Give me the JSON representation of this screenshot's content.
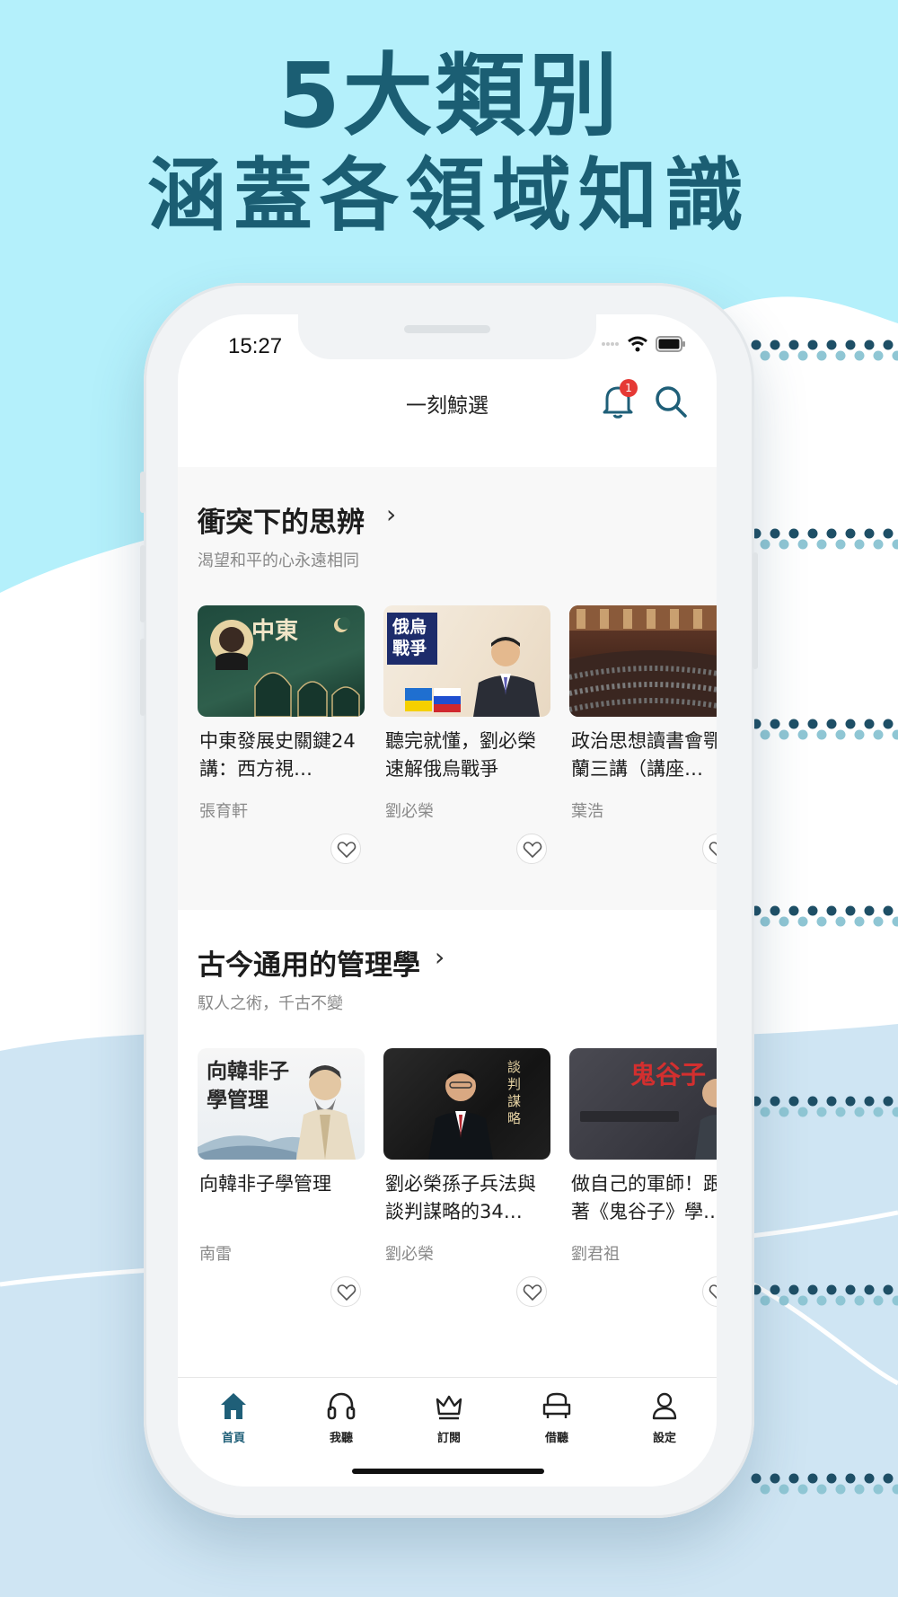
{
  "headline": {
    "line1": "5大類別",
    "line2": "涵蓋各領域知識"
  },
  "status_bar": {
    "time": "15:27"
  },
  "app_header": {
    "title": "一刻鯨選",
    "notification_count": "1"
  },
  "sections": [
    {
      "title": "衝突下的思辨",
      "subtitle": "渴望和平的心永遠相同",
      "cards": [
        {
          "title": "中東發展史關鍵24講：西方視…",
          "author": "張育軒",
          "cover_text": "中東"
        },
        {
          "title": "聽完就懂，劉必榮速解俄烏戰爭",
          "author": "劉必榮",
          "cover_text": "俄烏戰爭"
        },
        {
          "title": "政治思想讀書會鄂蘭三講（講座…",
          "author": "葉浩",
          "cover_text": ""
        }
      ]
    },
    {
      "title": "古今通用的管理學",
      "subtitle": "馭人之術，千古不變",
      "cards": [
        {
          "title": "向韓非子學管理",
          "author": "南雷",
          "cover_text": "向韓非子學管理"
        },
        {
          "title": "劉必榮孫子兵法與談判謀略的34…",
          "author": "劉必榮",
          "cover_text": "談判謀略"
        },
        {
          "title": "做自己的軍師！跟著《鬼谷子》學…",
          "author": "劉君祖",
          "cover_text": "鬼谷子"
        }
      ]
    }
  ],
  "tabs": [
    {
      "label": "首頁",
      "icon": "home-icon",
      "active": true
    },
    {
      "label": "我聽",
      "icon": "headphones-icon",
      "active": false
    },
    {
      "label": "訂閱",
      "icon": "crown-icon",
      "active": false
    },
    {
      "label": "借聽",
      "icon": "armchair-icon",
      "active": false
    },
    {
      "label": "設定",
      "icon": "user-icon",
      "active": false
    }
  ],
  "colors": {
    "accent": "#1f5f78",
    "sky": "#b4f0fb",
    "badge": "#e53935"
  }
}
